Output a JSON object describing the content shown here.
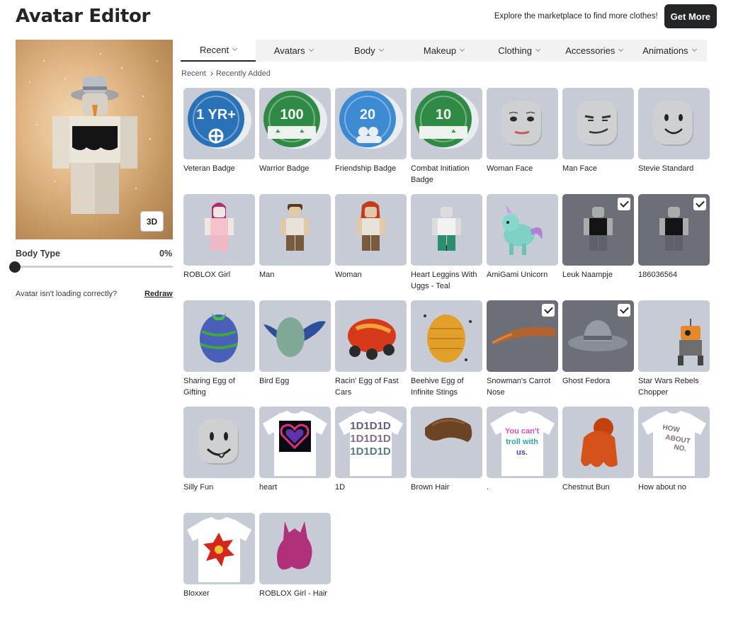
{
  "header": {
    "title": "Avatar Editor",
    "promo_text": "Explore the marketplace to find more clothes!",
    "get_more_label": "Get More"
  },
  "preview": {
    "toggle_label": "3D",
    "body_type_label": "Body Type",
    "body_type_value": "0%",
    "body_type_fraction": 0,
    "loading_text": "Avatar isn't loading correctly?",
    "redraw_label": "Redraw"
  },
  "tabs": [
    {
      "label": "Recent",
      "active": true
    },
    {
      "label": "Avatars",
      "active": false
    },
    {
      "label": "Body",
      "active": false
    },
    {
      "label": "Makeup",
      "active": false
    },
    {
      "label": "Clothing",
      "active": false
    },
    {
      "label": "Accessories",
      "active": false
    },
    {
      "label": "Animations",
      "active": false
    }
  ],
  "breadcrumb": [
    "Recent",
    "Recently Added"
  ],
  "items": [
    {
      "name": "Veteran Badge",
      "icon": "badge-1yr-icon",
      "selected": false
    },
    {
      "name": "Warrior Badge",
      "icon": "badge-100-icon",
      "selected": false
    },
    {
      "name": "Friendship Badge",
      "icon": "badge-20-icon",
      "selected": false
    },
    {
      "name": "Combat Initiation Badge",
      "icon": "badge-10-icon",
      "selected": false
    },
    {
      "name": "Woman Face",
      "icon": "woman-face-icon",
      "selected": false
    },
    {
      "name": "Man Face",
      "icon": "man-face-icon",
      "selected": false
    },
    {
      "name": "Stevie Standard",
      "icon": "smile-face-icon",
      "selected": false
    },
    {
      "name": "ROBLOX Girl",
      "icon": "roblox-girl-icon",
      "selected": false
    },
    {
      "name": "Man",
      "icon": "man-avatar-icon",
      "selected": false
    },
    {
      "name": "Woman",
      "icon": "woman-avatar-icon",
      "selected": false
    },
    {
      "name": "Heart Leggins With Uggs - Teal",
      "icon": "leggings-avatar-icon",
      "selected": false
    },
    {
      "name": "AmiGami Unicorn",
      "icon": "unicorn-icon",
      "selected": false
    },
    {
      "name": "Leuk Naampje",
      "icon": "outfit-avatar-icon",
      "selected": true
    },
    {
      "name": "186036564",
      "icon": "outfit-avatar-icon",
      "selected": true
    },
    {
      "name": "Sharing Egg of Gifting",
      "icon": "gift-egg-icon",
      "selected": false
    },
    {
      "name": "Bird Egg",
      "icon": "bird-egg-icon",
      "selected": false
    },
    {
      "name": "Racin' Egg of Fast Cars",
      "icon": "car-egg-icon",
      "selected": false
    },
    {
      "name": "Beehive Egg of Infinite Stings",
      "icon": "beehive-egg-icon",
      "selected": false
    },
    {
      "name": "Snowman's Carrot Nose",
      "icon": "carrot-nose-icon",
      "selected": true
    },
    {
      "name": "Ghost Fedora",
      "icon": "fedora-icon",
      "selected": true
    },
    {
      "name": "Star Wars Rebels Chopper",
      "icon": "droid-icon",
      "selected": false
    },
    {
      "name": "Silly Fun",
      "icon": "silly-face-icon",
      "selected": false
    },
    {
      "name": "heart",
      "icon": "heart-shirt-icon",
      "selected": false
    },
    {
      "name": "1D",
      "icon": "1d-shirt-icon",
      "selected": false
    },
    {
      "name": "Brown Hair",
      "icon": "brown-hair-icon",
      "selected": false
    },
    {
      "name": ".",
      "icon": "troll-shirt-icon",
      "selected": false
    },
    {
      "name": "Chestnut Bun",
      "icon": "chestnut-bun-icon",
      "selected": false
    },
    {
      "name": "How about no",
      "icon": "how-about-no-shirt-icon",
      "selected": false
    },
    {
      "name": "Bloxxer",
      "icon": "bloxxer-shirt-icon",
      "selected": false
    },
    {
      "name": "ROBLOX Girl - Hair",
      "icon": "pink-hair-icon",
      "selected": false
    }
  ],
  "shirt_text": {
    "troll_lines": [
      "You can't",
      "troll with",
      "us."
    ],
    "hana_lines": [
      "HOW",
      "ABOUT",
      "NO."
    ],
    "one_d": "1D"
  },
  "badge_text": {
    "veteran": "1 YR+",
    "warrior": "100",
    "friendship": "20",
    "combat": "10"
  },
  "colors": {
    "accent": "#232527",
    "tile_bg": "#c7cbd6",
    "tile_selected_bg": "#6c6f78",
    "badge_blue": "#2a72b8",
    "badge_green": "#2f8a45"
  }
}
